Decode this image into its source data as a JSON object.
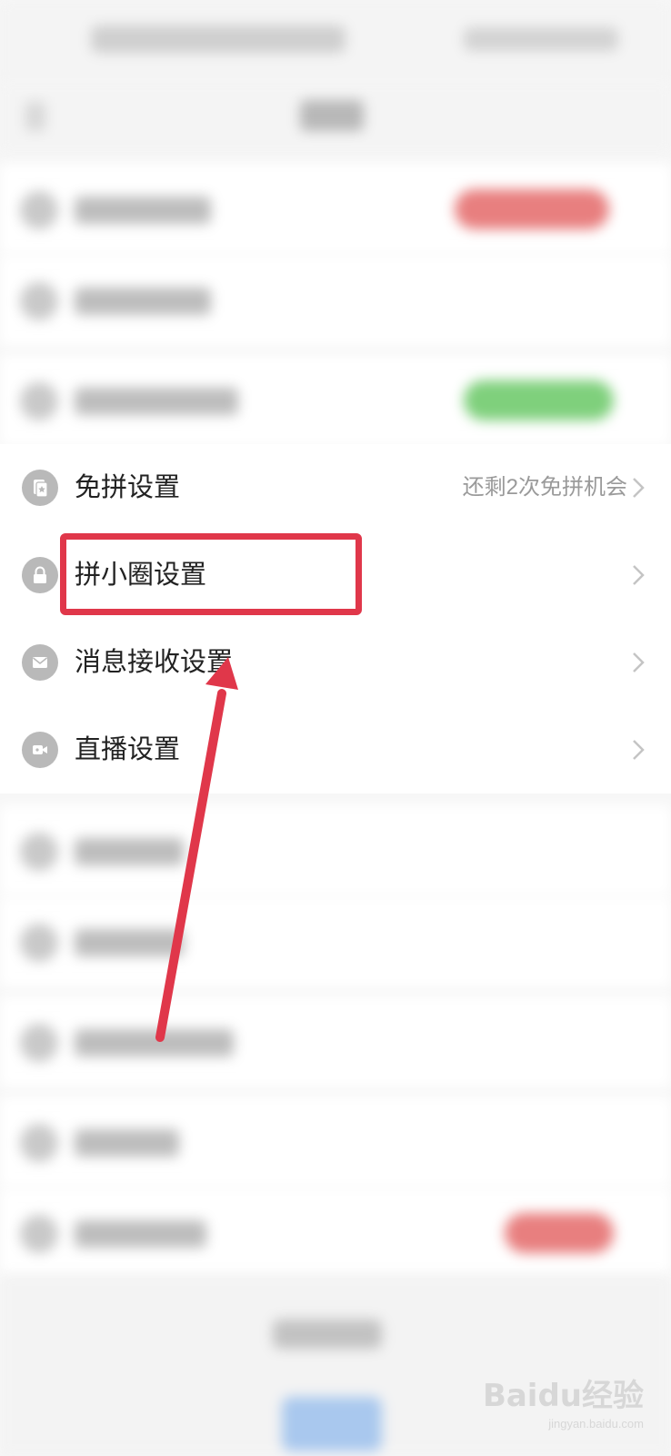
{
  "settings": {
    "items": [
      {
        "label": "免拼设置",
        "value": "还剩2次免拼机会",
        "icon": "card-star-icon"
      },
      {
        "label": "拼小圈设置",
        "value": "",
        "icon": "lock-icon"
      },
      {
        "label": "消息接收设置",
        "value": "",
        "icon": "mail-icon"
      },
      {
        "label": "直播设置",
        "value": "",
        "icon": "video-camera-icon"
      }
    ]
  },
  "annotation": {
    "highlight_color": "#e0374a",
    "arrow_color": "#e0374a"
  },
  "watermark": {
    "brand": "Baidu经验",
    "url": "jingyan.baidu.com"
  }
}
